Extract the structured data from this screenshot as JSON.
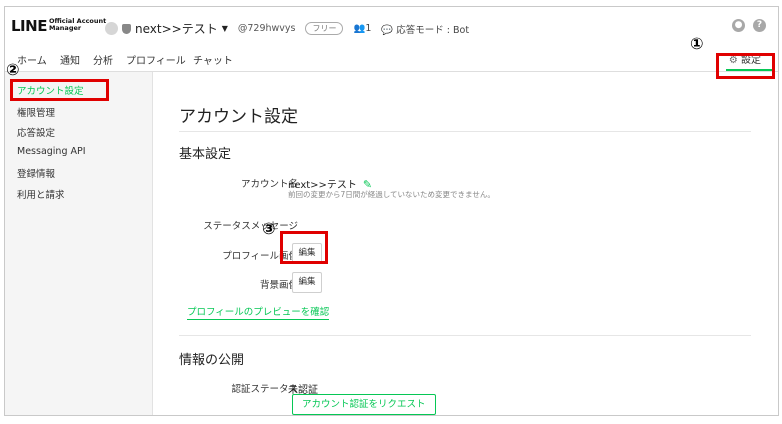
{
  "header": {
    "logo_main": "LINE",
    "logo_sub1": "Official Account",
    "logo_sub2": "Manager",
    "account_name": "next>>テスト",
    "account_id": "@729hwvys",
    "plan_badge": "フリー",
    "user_count": "1",
    "mode_label": "応答モード : Bot"
  },
  "tabs": [
    {
      "label": "ホーム"
    },
    {
      "label": "通知"
    },
    {
      "label": "分析"
    },
    {
      "label": "プロフィール"
    },
    {
      "label": "チャット"
    }
  ],
  "settings_tab": {
    "label": "設定"
  },
  "sidebar": {
    "items": [
      {
        "label": "アカウント設定"
      },
      {
        "label": "権限管理"
      },
      {
        "label": "応答設定"
      },
      {
        "label": "Messaging API"
      },
      {
        "label": "登録情報"
      },
      {
        "label": "利用と請求"
      }
    ]
  },
  "main": {
    "title": "アカウント設定",
    "basic_section": "基本設定",
    "account_name_label": "アカウント名",
    "account_name_value": "next>>テスト",
    "account_name_note": "前回の変更から7日間が経過していないため変更できません。",
    "status_message_label": "ステータスメッセージ",
    "profile_image_label": "プロフィール画像",
    "profile_image_edit": "編集",
    "background_image_label": "背景画像",
    "background_image_edit": "編集",
    "preview_link": "プロフィールのプレビューを確認",
    "public_section": "情報の公開",
    "verification_label": "認証ステータス",
    "verification_value": "未認証",
    "verification_button": "アカウント認証をリクエスト"
  },
  "annotations": {
    "marker1": "①",
    "marker2": "②",
    "marker3": "③",
    "highlight_color": "#e00000"
  },
  "colors": {
    "accent": "#06c755"
  }
}
